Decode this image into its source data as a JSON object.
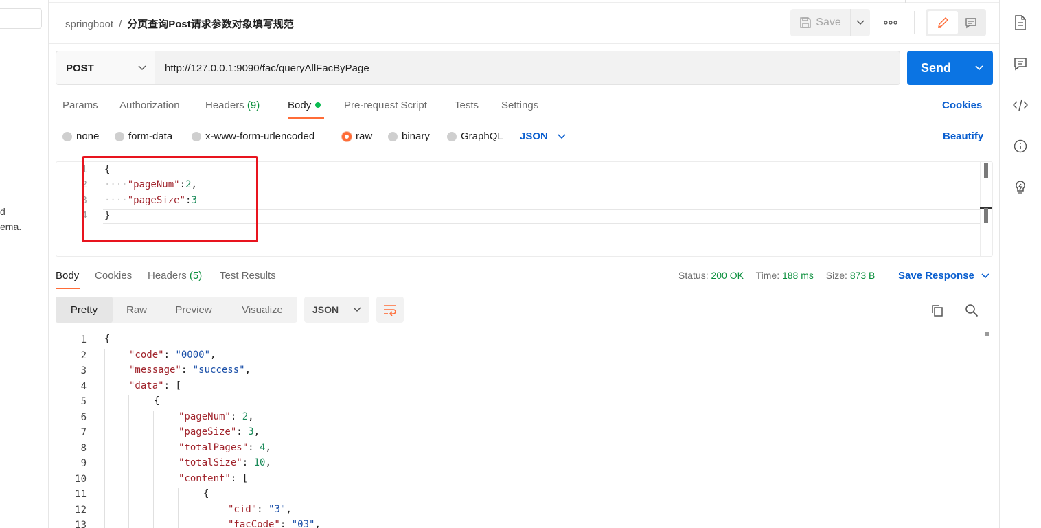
{
  "sidebar": {
    "partial_line_1": "d",
    "partial_line_2": "ema."
  },
  "header": {
    "workspace": "springboot",
    "separator": "/",
    "request_name": "分页查询Post请求参数对象填写规范",
    "save_label": "Save",
    "more_label": "ooo"
  },
  "request": {
    "method": "POST",
    "url": "http://127.0.0.1:9090/fac/queryAllFacByPage",
    "send_label": "Send",
    "tabs": {
      "params": "Params",
      "authorization": "Authorization",
      "headers": "Headers",
      "headers_count": "(9)",
      "body": "Body",
      "pre_request": "Pre-request Script",
      "tests": "Tests",
      "settings": "Settings"
    },
    "cookies_label": "Cookies",
    "body_types": {
      "none": "none",
      "form_data": "form-data",
      "urlencoded": "x-www-form-urlencoded",
      "raw": "raw",
      "binary": "binary",
      "graphql": "GraphQL"
    },
    "selected_body_type": "raw",
    "language": "JSON",
    "beautify_label": "Beautify",
    "body_lines": {
      "numbers": [
        "1",
        "2",
        "3",
        "4"
      ],
      "l1": "{",
      "l2_key": "\"pageNum\"",
      "l2_colon": ":",
      "l2_val": "2",
      "l2_comma": ",",
      "l3_key": "\"pageSize\"",
      "l3_colon": ":",
      "l3_val": "3",
      "l4": "}",
      "indent_dots": "····"
    }
  },
  "response": {
    "tabs": {
      "body": "Body",
      "cookies": "Cookies",
      "headers": "Headers",
      "headers_count": "(5)",
      "test_results": "Test Results"
    },
    "status_label": "Status:",
    "status_value": "200 OK",
    "time_label": "Time:",
    "time_value": "188 ms",
    "size_label": "Size:",
    "size_value": "873 B",
    "save_response_label": "Save Response",
    "views": {
      "pretty": "Pretty",
      "raw": "Raw",
      "preview": "Preview",
      "visualize": "Visualize"
    },
    "format": "JSON",
    "line_numbers": [
      "1",
      "2",
      "3",
      "4",
      "5",
      "6",
      "7",
      "8",
      "9",
      "10",
      "11",
      "12",
      "13"
    ],
    "code": {
      "l1": "{",
      "l2_key": "\"code\"",
      "l2_val": "\"0000\"",
      "l3_key": "\"message\"",
      "l3_val": "\"success\"",
      "l4_key": "\"data\"",
      "l4_open": "[",
      "l5": "{",
      "l6_key": "\"pageNum\"",
      "l6_val": "2",
      "l7_key": "\"pageSize\"",
      "l7_val": "3",
      "l8_key": "\"totalPages\"",
      "l8_val": "4",
      "l9_key": "\"totalSize\"",
      "l9_val": "10",
      "l10_key": "\"content\"",
      "l10_open": "[",
      "l11": "{",
      "l12_key": "\"cid\"",
      "l12_val": "\"3\"",
      "l13_key": "\"facCode\"",
      "l13_val": "\"03\"",
      "colon": ": ",
      "comma": ","
    }
  },
  "colors": {
    "accent": "#ff6c37",
    "send": "#0b74e3",
    "link": "#0b5fcf",
    "success": "#0a8f3c",
    "highlight_box": "#e8141e"
  }
}
